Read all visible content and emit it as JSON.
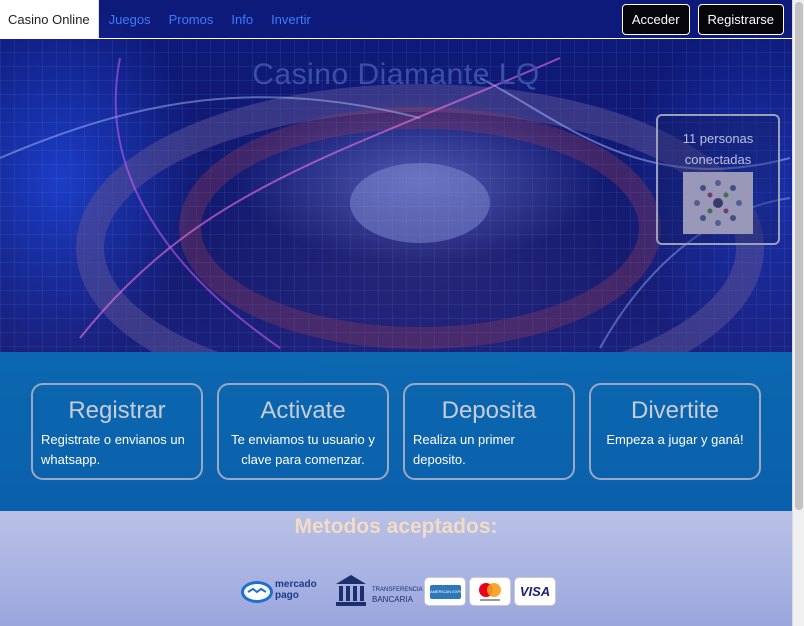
{
  "nav": {
    "brand": "Casino Online",
    "links": [
      "Juegos",
      "Promos",
      "Info",
      "Invertir"
    ],
    "login": "Acceder",
    "register": "Registrarse"
  },
  "hero": {
    "title": "Casino Diamante LQ",
    "online_line1": "11 personas",
    "online_line2": "conectadas"
  },
  "steps": [
    {
      "title": "Registrar",
      "desc": "Registrate o envianos un whatsapp."
    },
    {
      "title": "Activate",
      "desc": "Te enviamos tu usuario y clave para comenzar."
    },
    {
      "title": "Deposita",
      "desc": "Realiza un primer deposito."
    },
    {
      "title": "Divertite",
      "desc": "Empeza a jugar y ganá!"
    }
  ],
  "payments": {
    "title": "Metodos aceptados:",
    "mercadopago_line1": "mercado",
    "mercadopago_line2": "pago",
    "transfer_line1": "TRANSFERENCIA",
    "transfer_line2": "BANCARIA",
    "amex": "AMERICAN EXPRESS",
    "visa": "VISA"
  },
  "colors": {
    "nav_link": "#3d7cff",
    "steps_band": "#0a6eb4",
    "payments_title": "#f2dcc6"
  },
  "icons": [
    "mercadopago-logo",
    "bank-icon",
    "amex-logo",
    "mastercard-logo",
    "visa-logo"
  ]
}
